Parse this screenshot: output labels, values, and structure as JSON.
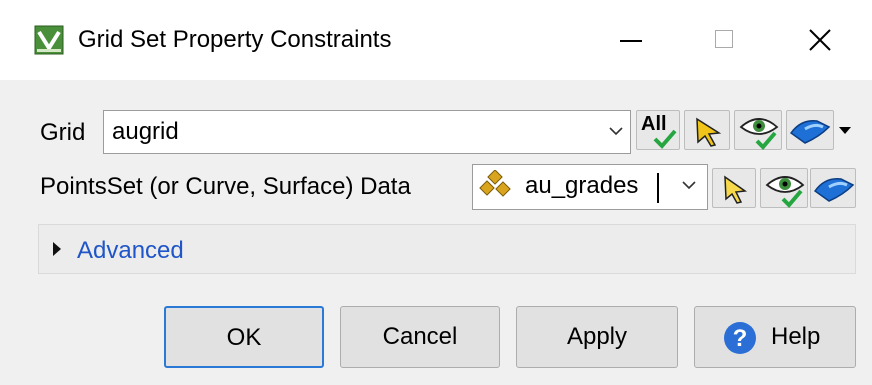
{
  "window": {
    "title": "Grid Set Property Constraints",
    "controls": [
      "minimize-icon",
      "maximize-icon",
      "close-icon"
    ]
  },
  "grid": {
    "label": "Grid",
    "value": "augrid",
    "tools": {
      "all_label": "All",
      "icons": [
        "all-select-icon",
        "pick-arrow-icon",
        "visibility-eye-icon",
        "surface-icon",
        "dropdown-arrow-icon"
      ]
    }
  },
  "pointset": {
    "label": "PointsSet (or Curve, Surface) Data",
    "value": "au_grades",
    "icons": [
      "points-icon",
      "pick-arrow-icon",
      "visibility-eye-icon",
      "surface-icon"
    ]
  },
  "advanced": {
    "label": "Advanced"
  },
  "buttons": {
    "ok": "OK",
    "cancel": "Cancel",
    "apply": "Apply",
    "help": "Help"
  },
  "colors": {
    "link_blue": "#1f55c8",
    "focus_blue": "#2b79d6",
    "check_green": "#26a641",
    "window_bg": "#f0f0f0"
  }
}
